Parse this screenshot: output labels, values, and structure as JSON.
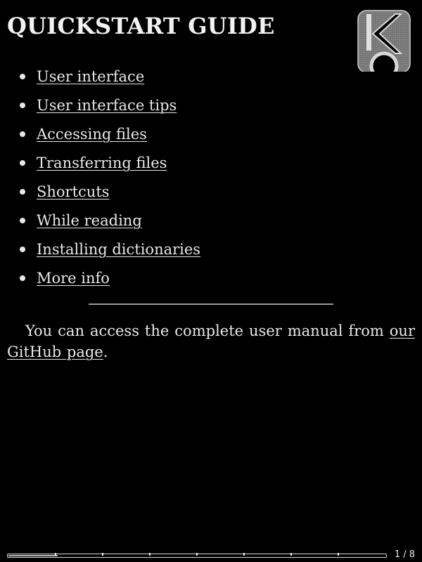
{
  "header": {
    "title": "QUICKSTART GUIDE",
    "logo_icon": "koreader-logo-icon"
  },
  "toc": [
    {
      "label": "User interface"
    },
    {
      "label": "User interface tips"
    },
    {
      "label": "Accessing files"
    },
    {
      "label": "Transferring files"
    },
    {
      "label": "Shortcuts"
    },
    {
      "label": "While reading"
    },
    {
      "label": "Installing dictionaries"
    },
    {
      "label": "More info"
    }
  ],
  "manual": {
    "text_before": "You can access the complete user manual from ",
    "link_label": "our GitHub page",
    "text_after": "."
  },
  "footer": {
    "page_counter": "1 / 8",
    "progress_fraction": 0.13,
    "chapter_markers": 8
  },
  "colors": {
    "background": "#000000",
    "text": "#e8e8e8",
    "divider": "#9a9a9a"
  }
}
